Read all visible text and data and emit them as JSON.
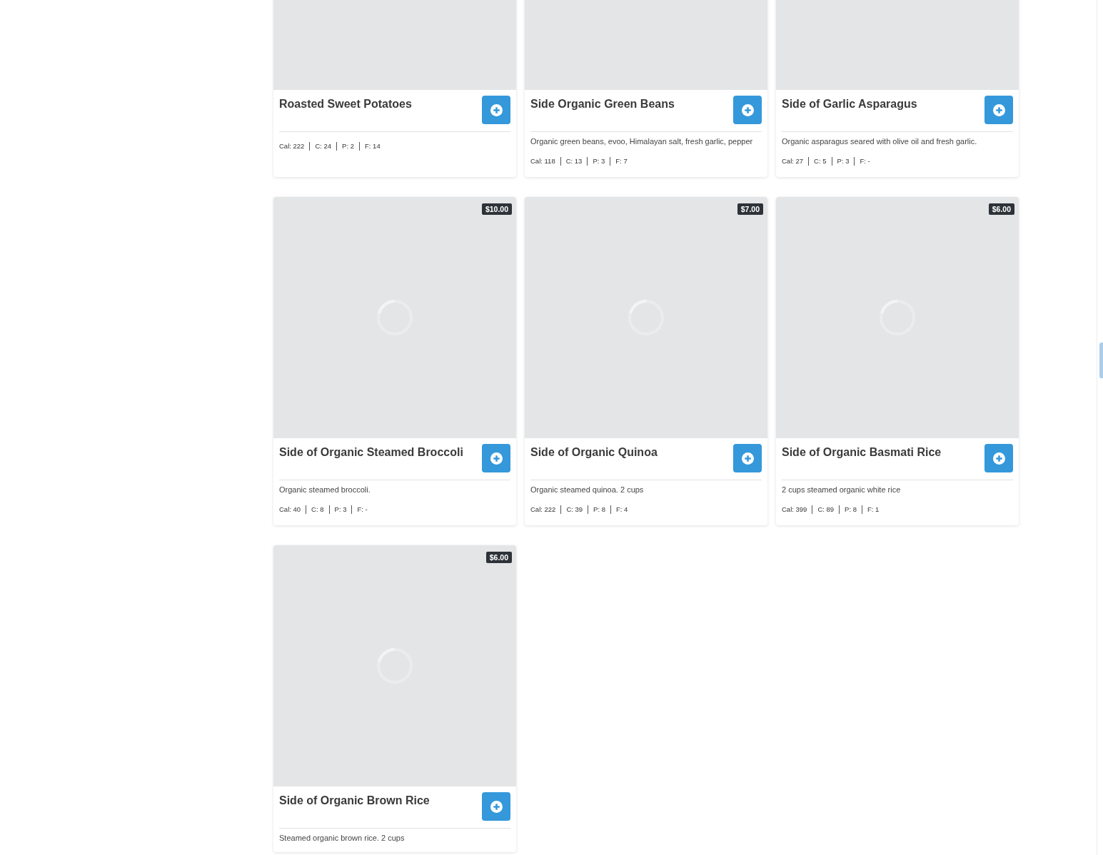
{
  "cards": [
    {
      "title": "Roasted Sweet Potatoes",
      "macros": [
        "Cal: 222",
        "C: 24",
        "P: 2",
        "F: 14"
      ]
    },
    {
      "title": "Side Organic Green Beans",
      "description": "Organic green beans, evoo, Himalayan salt, fresh garlic, pepper",
      "macros": [
        "Cal: 118",
        "C: 13",
        "P: 3",
        "F: 7"
      ]
    },
    {
      "title": "Side of Garlic Asparagus",
      "description": "Organic asparagus seared with olive oil and fresh garlic.",
      "macros": [
        "Cal: 27",
        "C: 5",
        "P: 3",
        "F: -"
      ]
    },
    {
      "title": "Side of Organic Steamed Broccoli",
      "price": "$10.00",
      "loading": true,
      "description": "Organic steamed broccoli.",
      "macros": [
        "Cal: 40",
        "C: 8",
        "P: 3",
        "F: -"
      ]
    },
    {
      "title": "Side of Organic Quinoa",
      "price": "$7.00",
      "loading": true,
      "description": "Organic steamed quinoa. 2 cups",
      "macros": [
        "Cal: 222",
        "C: 39",
        "P: 8",
        "F: 4"
      ]
    },
    {
      "title": "Side of Organic Basmati Rice",
      "price": "$6.00",
      "loading": true,
      "description": "2 cups steamed organic white rice",
      "macros": [
        "Cal: 399",
        "C: 89",
        "P: 8",
        "F: 1"
      ]
    },
    {
      "title": "Side of Organic Brown Rice",
      "price": "$6.00",
      "loading": true,
      "description": "Steamed organic brown rice. 2 cups"
    }
  ]
}
